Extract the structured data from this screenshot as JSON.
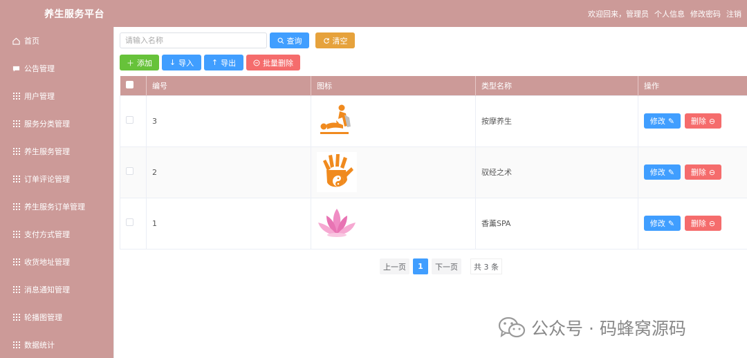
{
  "header": {
    "title": "养生服务平台",
    "welcome": "欢迎回来，管理员",
    "profile": "个人信息",
    "change_password": "修改密码",
    "logout": "注销"
  },
  "sidebar": {
    "items": [
      {
        "label": "首页",
        "icon": "home-icon"
      },
      {
        "label": "公告管理",
        "icon": "message-icon"
      },
      {
        "label": "用户管理",
        "icon": "grid-icon"
      },
      {
        "label": "服务分类管理",
        "icon": "grid-icon"
      },
      {
        "label": "养生服务管理",
        "icon": "grid-icon"
      },
      {
        "label": "订单评论管理",
        "icon": "grid-icon"
      },
      {
        "label": "养生服务订单管理",
        "icon": "grid-icon"
      },
      {
        "label": "支付方式管理",
        "icon": "grid-icon"
      },
      {
        "label": "收货地址管理",
        "icon": "grid-icon"
      },
      {
        "label": "消息通知管理",
        "icon": "grid-icon"
      },
      {
        "label": "轮播图管理",
        "icon": "grid-icon"
      },
      {
        "label": "数据统计",
        "icon": "grid-icon"
      }
    ]
  },
  "search": {
    "placeholder": "请输入名称",
    "query_label": "查询",
    "clear_label": "清空"
  },
  "actions": {
    "add": "添加",
    "import": "导入",
    "export": "导出",
    "batch_delete": "批量删除"
  },
  "table": {
    "headers": [
      "编号",
      "图标",
      "类型名称",
      "操作"
    ],
    "rows": [
      {
        "id": "3",
        "icon": "massage-icon",
        "name": "按摩养生",
        "edit": "修改",
        "delete": "删除"
      },
      {
        "id": "2",
        "icon": "hand-taiji-icon",
        "name": "驭经之术",
        "edit": "修改",
        "delete": "删除"
      },
      {
        "id": "1",
        "icon": "lotus-icon",
        "name": "香薰SPA",
        "edit": "修改",
        "delete": "删除"
      }
    ]
  },
  "pagination": {
    "prev": "上一页",
    "current": "1",
    "next": "下一页",
    "total": "共 3 条"
  },
  "watermark": {
    "text": "公众号 · 码蜂窝源码"
  },
  "colors": {
    "theme": "#cc9a98",
    "primary": "#409eff",
    "success": "#67c23a",
    "warning": "#e6a23c",
    "danger": "#f56c6c"
  }
}
